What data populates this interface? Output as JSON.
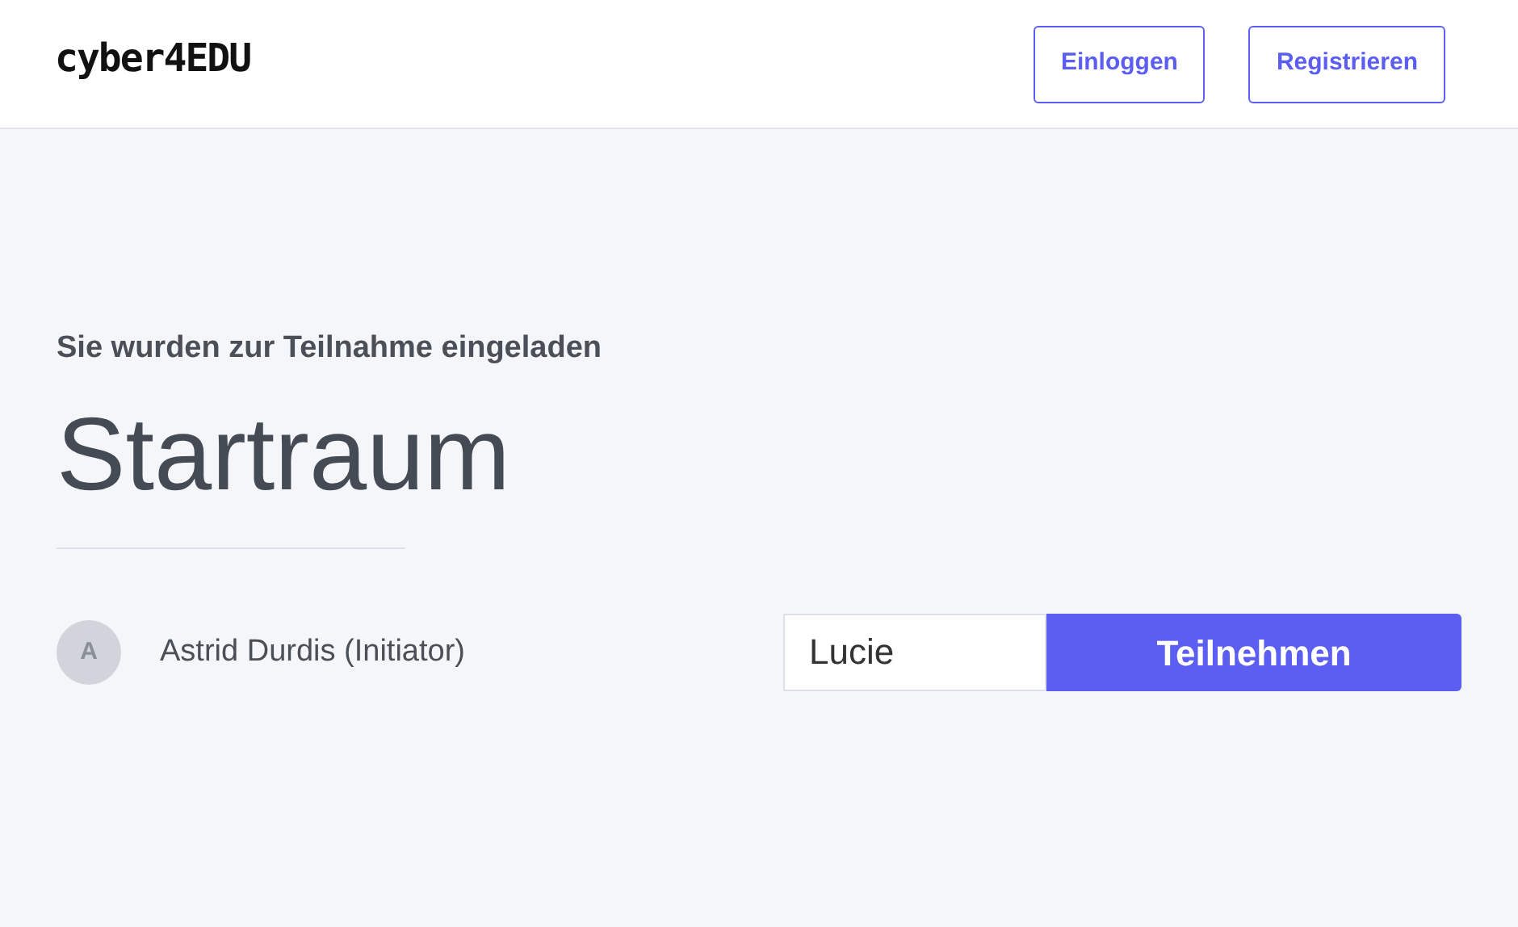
{
  "header": {
    "logo": "cyber4EDU",
    "buttons": [
      "Einloggen",
      "Registrieren"
    ]
  },
  "invite": {
    "subtitle": "Sie wurden zur Teilnahme eingeladen",
    "room": "Startraum",
    "participants": [
      {
        "initial": "A",
        "name": "Astrid Durdis (Initiator)"
      }
    ],
    "join": {
      "value": "Lucie",
      "button": "Teilnehmen"
    }
  }
}
